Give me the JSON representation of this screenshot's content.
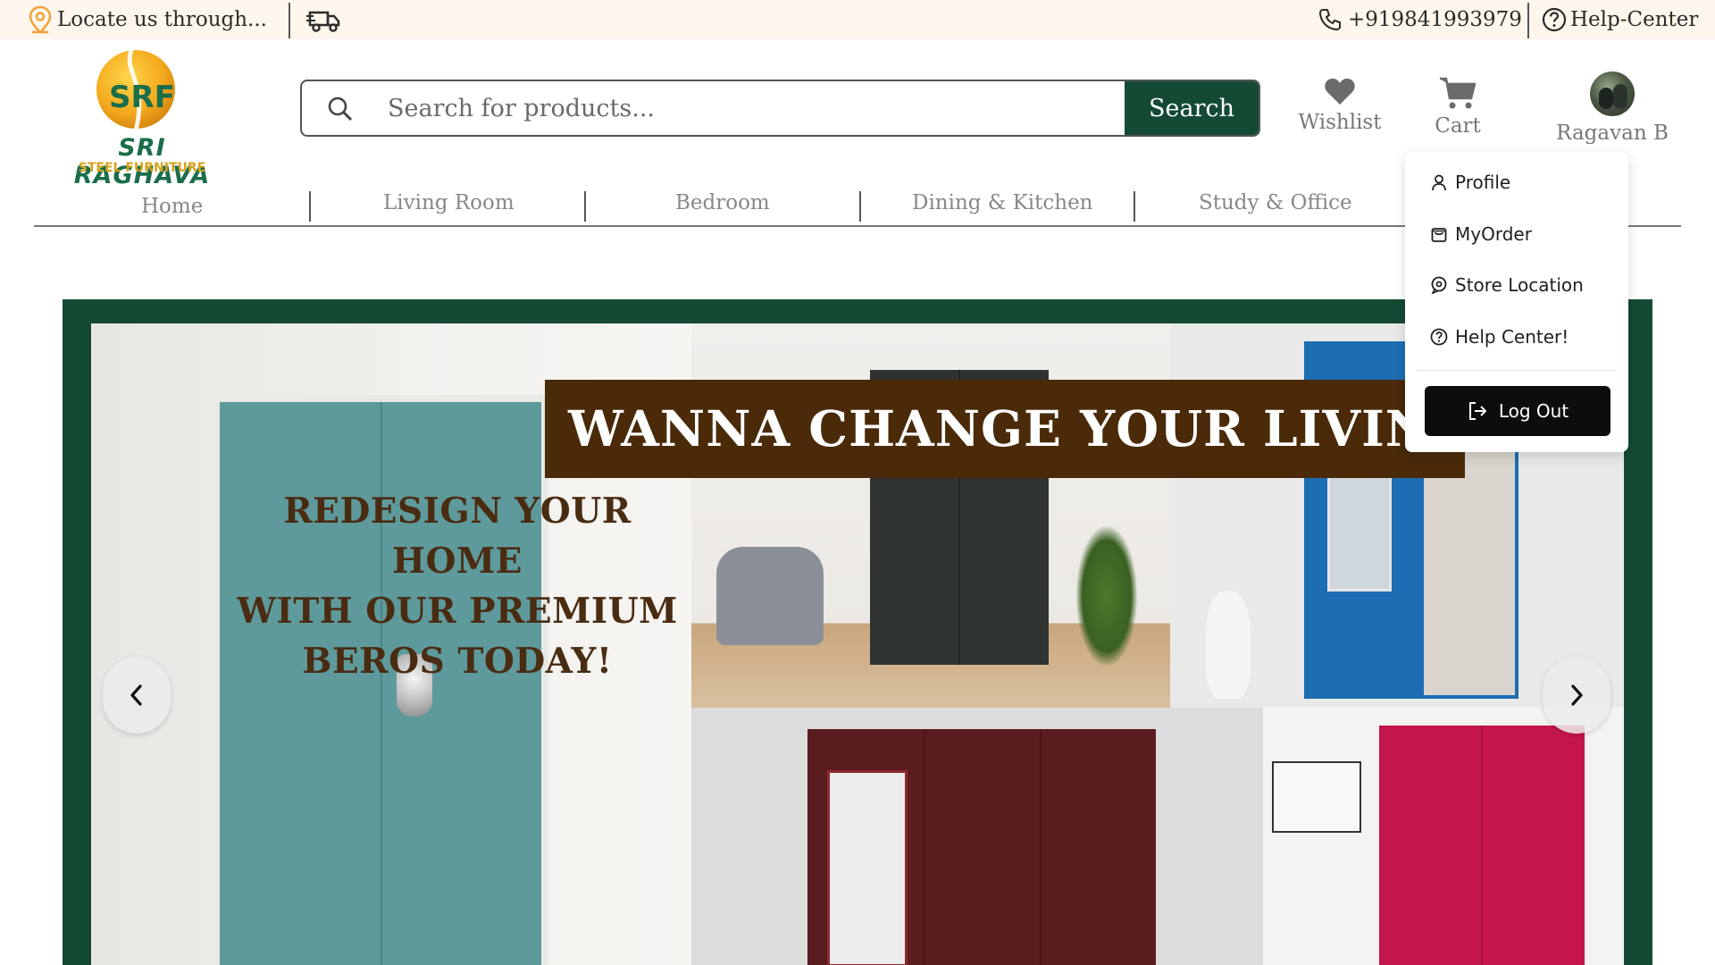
{
  "topbar": {
    "location_text": "Locate us through...",
    "phone": "+919841993979",
    "help_center": "Help-Center"
  },
  "logo": {
    "mark": "SRF",
    "brand_line1": "SRI RAGHAVA",
    "brand_line2": "STEEL FURNITURE"
  },
  "search": {
    "placeholder": "Search for products...",
    "value": "",
    "button_label": "Search"
  },
  "header": {
    "wishlist_label": "Wishlist",
    "cart_label": "Cart",
    "user_name": "Ragavan B"
  },
  "nav": {
    "items": [
      {
        "label": "Home"
      },
      {
        "label": "Living Room"
      },
      {
        "label": "Bedroom"
      },
      {
        "label": "Dining & Kitchen"
      },
      {
        "label": "Study & Office"
      }
    ]
  },
  "banner": {
    "headline": "WANNA CHANGE YOUR LIVING",
    "tagline_line1": "REDESIGN YOUR HOME",
    "tagline_line2": "WITH OUR PREMIUM",
    "tagline_line3": "BEROS TODAY!"
  },
  "user_menu": {
    "items": [
      {
        "label": "Profile",
        "icon": "user-icon"
      },
      {
        "label": "MyOrder",
        "icon": "shopping-bag-icon"
      },
      {
        "label": "Store Location",
        "icon": "location-pin-icon"
      },
      {
        "label": "Help Center!",
        "icon": "help-circle-icon"
      }
    ],
    "logout_label": "Log Out"
  },
  "colors": {
    "brand_green": "#144a34",
    "topbar_bg": "#fdf6ec",
    "headline_band": "#4a2a08"
  }
}
